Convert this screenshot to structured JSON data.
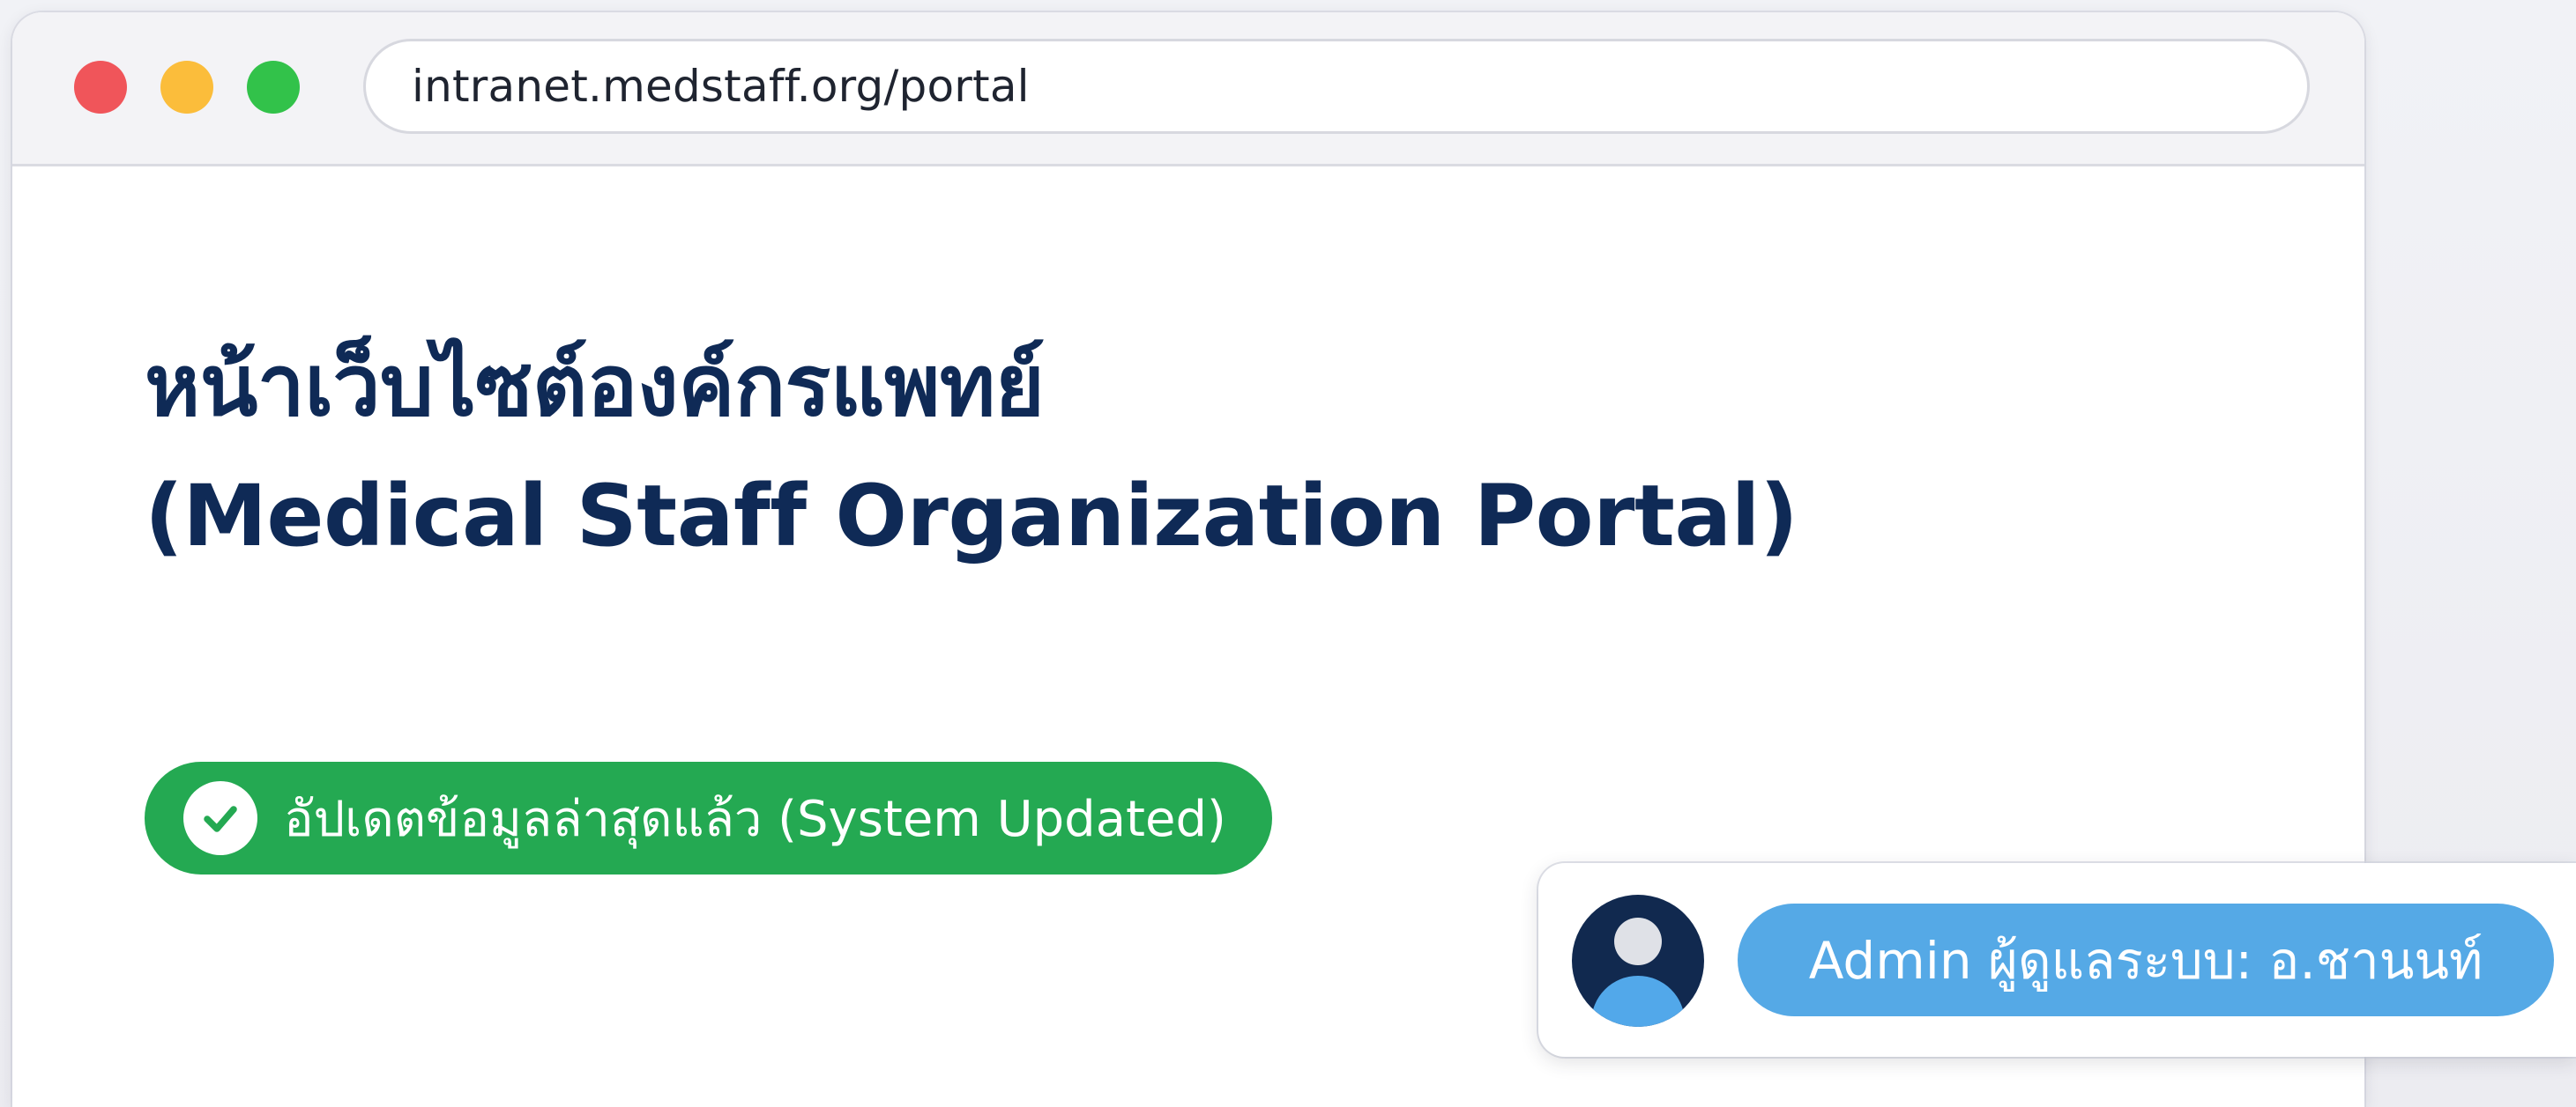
{
  "browser": {
    "url": "intranet.medstaff.org/portal",
    "window_controls": [
      {
        "name": "close",
        "color": "#f0555a"
      },
      {
        "name": "minimize",
        "color": "#fbbd3b"
      },
      {
        "name": "maximize",
        "color": "#32c24a"
      }
    ]
  },
  "page": {
    "title_line1": "หน้าเว็บไซต์องค์กรแพทย์",
    "title_line2": "(Medical Staff Organization Portal)",
    "title_color": "#0f2a56"
  },
  "status": {
    "icon": "check-circle-icon",
    "text": "อัปเดตข้อมูลล่าสุดแล้ว (System Updated)",
    "color": "#24a952"
  },
  "admin": {
    "avatar_icon": "user-avatar-icon",
    "label": "Admin ผู้ดูแลระบบ: อ.ชานนท์",
    "color": "#55a9e6"
  }
}
